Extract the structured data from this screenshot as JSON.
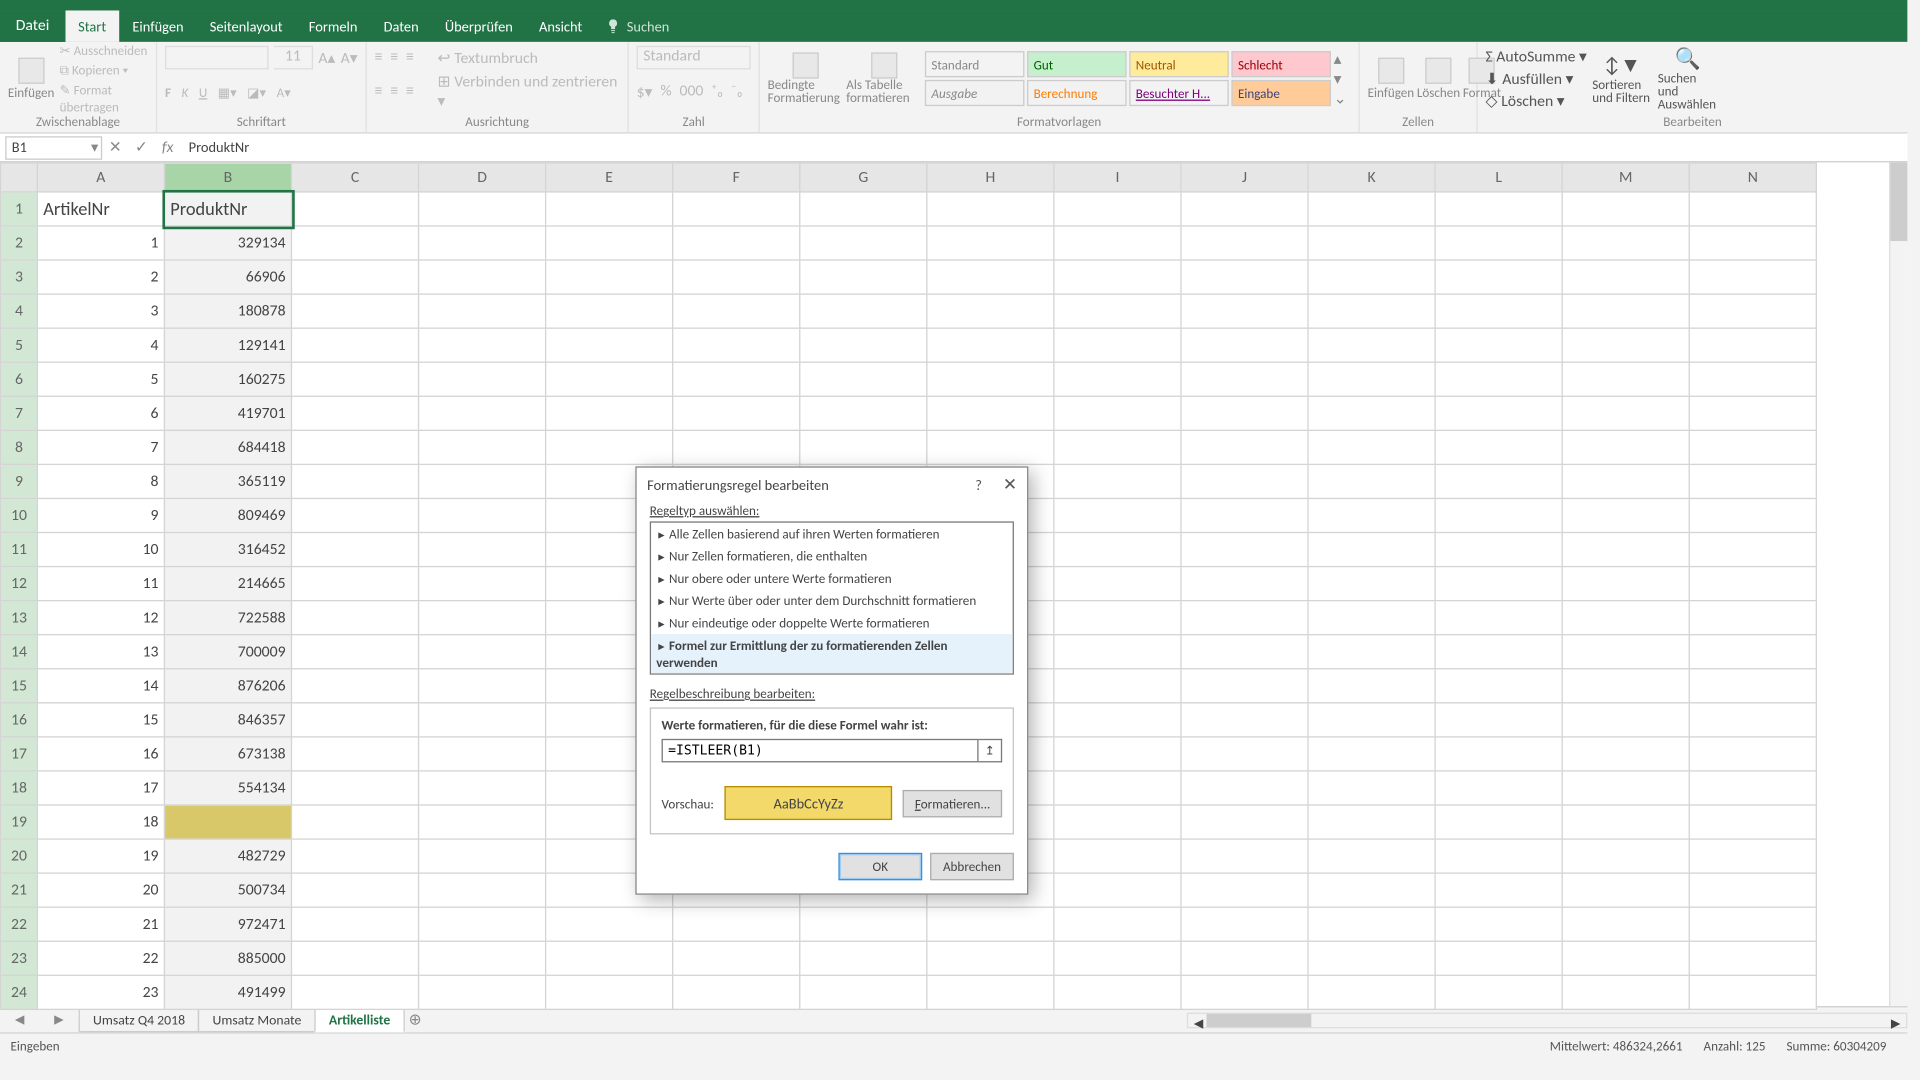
{
  "tabs": {
    "file": "Datei",
    "start": "Start",
    "insert": "Einfügen",
    "layout": "Seitenlayout",
    "formulas": "Formeln",
    "data": "Daten",
    "review": "Überprüfen",
    "view": "Ansicht",
    "search": "Suchen"
  },
  "ribbon": {
    "clipboard": {
      "paste": "Einfügen",
      "cut": "Ausschneiden",
      "copy": "Kopieren",
      "format_painter": "Format übertragen",
      "name": "Zwischenablage"
    },
    "font": {
      "size": "11",
      "name": "Schriftart"
    },
    "alignment": {
      "wrap": "Textumbruch",
      "merge": "Verbinden und zentrieren",
      "name": "Ausrichtung"
    },
    "number": {
      "format": "Standard",
      "name": "Zahl"
    },
    "styles": {
      "cond": "Bedingte Formatierung",
      "astable": "Als Tabelle formatieren",
      "s1": "Standard",
      "s2": "Gut",
      "s3": "Neutral",
      "s4": "Schlecht",
      "s5": "Ausgabe",
      "s6": "Berechnung",
      "s7": "Besuchter H...",
      "s8": "Eingabe",
      "name": "Formatvorlagen"
    },
    "cells": {
      "insert": "Einfügen",
      "delete": "Löschen",
      "format": "Format",
      "name": "Zellen"
    },
    "editing": {
      "autosum": "AutoSumme",
      "fill": "Ausfüllen",
      "clear": "Löschen",
      "sort": "Sortieren und Filtern",
      "find": "Suchen und Auswählen",
      "name": "Bearbeiten"
    }
  },
  "namebox": "B1",
  "formula": "ProduktNr",
  "columns": [
    "A",
    "B",
    "C",
    "D",
    "E",
    "F",
    "G",
    "H",
    "I",
    "J",
    "K",
    "L",
    "M",
    "N"
  ],
  "headers": {
    "A": "ArtikelNr",
    "B": "ProduktNr"
  },
  "rows": [
    {
      "n": 1,
      "a": "",
      "b": ""
    },
    {
      "n": 2,
      "a": "1",
      "b": "329134"
    },
    {
      "n": 3,
      "a": "2",
      "b": "66906"
    },
    {
      "n": 4,
      "a": "3",
      "b": "180878"
    },
    {
      "n": 5,
      "a": "4",
      "b": "129141"
    },
    {
      "n": 6,
      "a": "5",
      "b": "160275"
    },
    {
      "n": 7,
      "a": "6",
      "b": "419701"
    },
    {
      "n": 8,
      "a": "7",
      "b": "684418"
    },
    {
      "n": 9,
      "a": "8",
      "b": "365119"
    },
    {
      "n": 10,
      "a": "9",
      "b": "809469"
    },
    {
      "n": 11,
      "a": "10",
      "b": "316452"
    },
    {
      "n": 12,
      "a": "11",
      "b": "214665"
    },
    {
      "n": 13,
      "a": "12",
      "b": "722588"
    },
    {
      "n": 14,
      "a": "13",
      "b": "700009"
    },
    {
      "n": 15,
      "a": "14",
      "b": "876206"
    },
    {
      "n": 16,
      "a": "15",
      "b": "846357"
    },
    {
      "n": 17,
      "a": "16",
      "b": "673138"
    },
    {
      "n": 18,
      "a": "17",
      "b": "554134"
    },
    {
      "n": 19,
      "a": "18",
      "b": ""
    },
    {
      "n": 20,
      "a": "19",
      "b": "482729"
    },
    {
      "n": 21,
      "a": "20",
      "b": "500734"
    },
    {
      "n": 22,
      "a": "21",
      "b": "972471"
    },
    {
      "n": 23,
      "a": "22",
      "b": "885000"
    },
    {
      "n": 24,
      "a": "23",
      "b": "491499"
    }
  ],
  "sheets": {
    "s1": "Umsatz Q4 2018",
    "s2": "Umsatz Monate",
    "s3": "Artikelliste"
  },
  "dialog": {
    "title": "Formatierungsregel bearbeiten",
    "select_label": "Regeltyp auswählen:",
    "rules": [
      "Alle Zellen basierend auf ihren Werten formatieren",
      "Nur Zellen formatieren, die enthalten",
      "Nur obere oder untere Werte formatieren",
      "Nur Werte über oder unter dem Durchschnitt formatieren",
      "Nur eindeutige oder doppelte Werte formatieren",
      "Formel zur Ermittlung der zu formatierenden Zellen verwenden"
    ],
    "desc_label": "Regelbeschreibung bearbeiten:",
    "formula_label": "Werte formatieren, für die diese Formel wahr ist:",
    "formula_value": "=ISTLEER(B1)",
    "preview_label": "Vorschau:",
    "preview_text": "AaBbCcYyZz",
    "format_btn": "Formatieren...",
    "ok": "OK",
    "cancel": "Abbrechen"
  },
  "status": {
    "mode": "Eingeben",
    "avg_lbl": "Mittelwert:",
    "avg": "486324,2661",
    "cnt_lbl": "Anzahl:",
    "cnt": "125",
    "sum_lbl": "Summe:",
    "sum": "60304209"
  }
}
